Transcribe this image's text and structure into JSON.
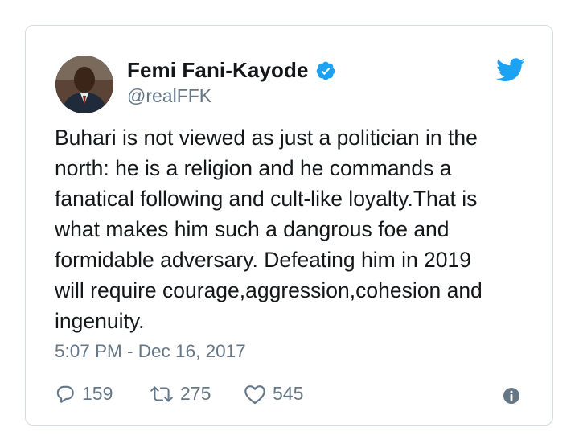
{
  "tweet": {
    "author": {
      "display_name": "Femi Fani-Kayode",
      "handle": "@realFFK",
      "verified": true
    },
    "text": "Buhari is not viewed as just a politician in the\nnorth: he is a religion and he commands a\nfanatical following and cult-like loyalty.That is\nwhat makes him such a dangrous foe and\nformidable adversary. Defeating him in 2019\nwill require courage,aggression,cohesion and\ningenuity.",
    "timestamp": "5:07 PM - Dec 16, 2017",
    "actions": {
      "reply_count": "159",
      "retweet_count": "275",
      "like_count": "545"
    }
  },
  "icons": {
    "brand": "twitter-bird-icon",
    "verified": "verified-badge-icon",
    "reply": "reply-icon",
    "retweet": "retweet-icon",
    "like": "heart-icon",
    "info": "info-icon"
  },
  "colors": {
    "brand_blue": "#1da1f2",
    "text_primary": "#14171a",
    "text_secondary": "#657786",
    "border": "#d5dbe0"
  }
}
